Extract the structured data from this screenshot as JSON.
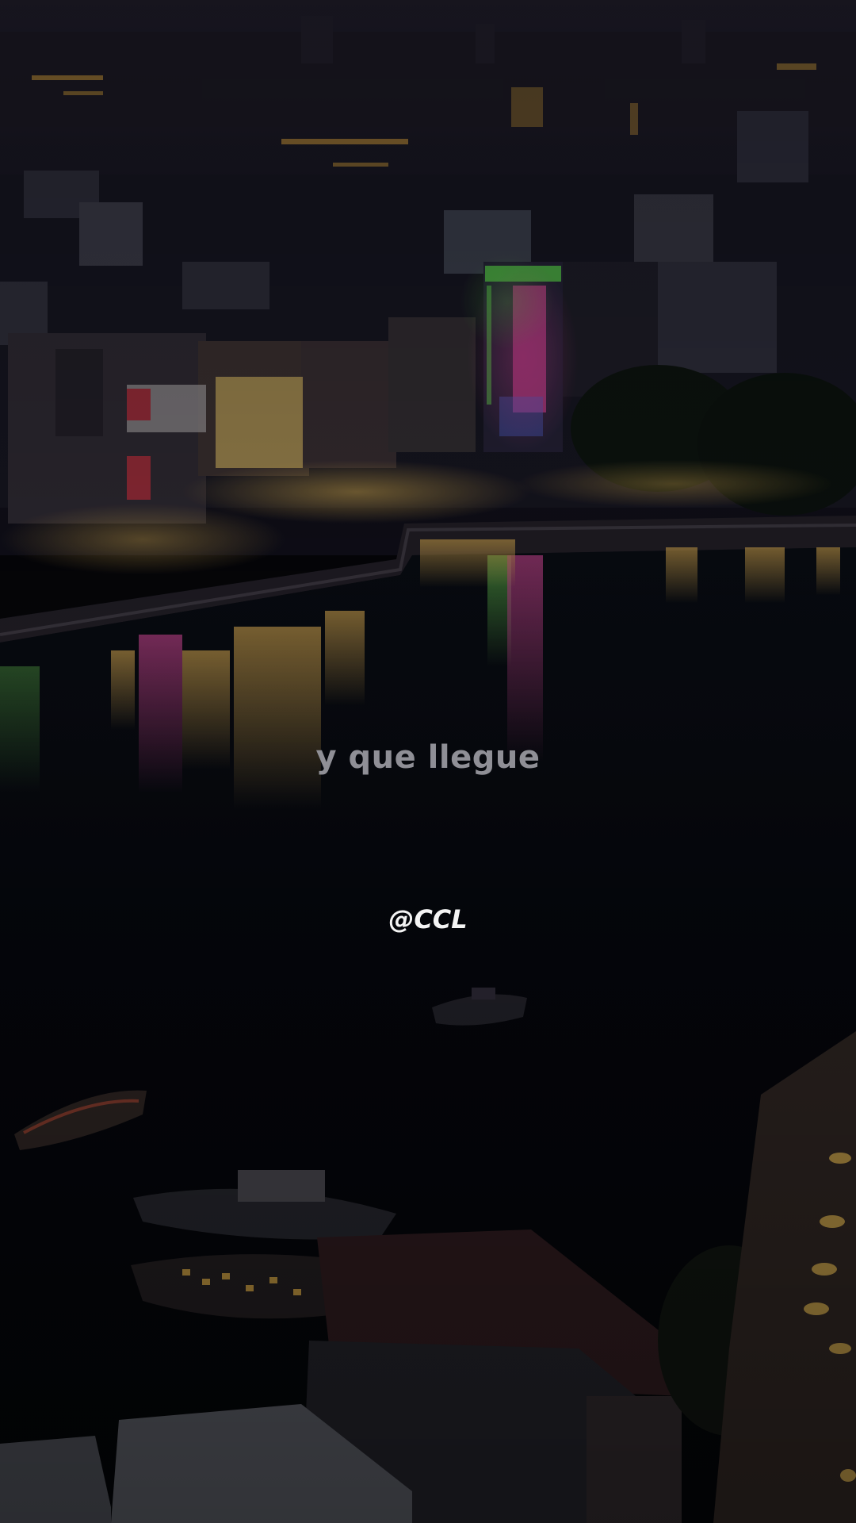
{
  "overlay": {
    "lyric": "y que llegue",
    "watermark": "@CCL"
  },
  "scene": {
    "description_tag": "night-city-waterfront",
    "colors": {
      "sky": "#1b1a2a",
      "water": "#06070d",
      "neon_green": "#6cff5a",
      "neon_pink": "#ff4fb4",
      "warm_light": "#f4c35a"
    }
  }
}
